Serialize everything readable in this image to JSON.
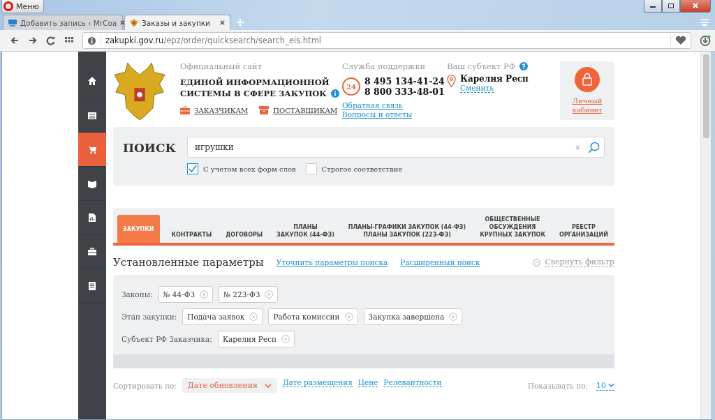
{
  "browser": {
    "menu_label": "Меню",
    "tabs": [
      {
        "title": "Добавить запись ‹ MrCoa",
        "selected": false
      },
      {
        "title": "Заказы и закупки",
        "selected": true
      }
    ],
    "url_host": "zakupki.gov.ru",
    "url_path": "/epz/order/quicksearch/search_eis.html"
  },
  "sidebar": [
    {
      "selected": false
    },
    {
      "selected": false
    },
    {
      "selected": true
    },
    {
      "selected": false
    },
    {
      "selected": false
    },
    {
      "selected": false
    },
    {
      "selected": false
    }
  ],
  "header": {
    "site_caption": "Официальный сайт",
    "site_title_1": "ЕДИНОЙ ИНФОРМАЦИОННОЙ",
    "site_title_2": "СИСТЕМЫ В СФЕРЕ ЗАКУПОК",
    "audience_links": [
      "ЗАКАЗЧИКАМ",
      "ПОСТАВЩИКАМ"
    ],
    "support_caption": "Служба поддержки",
    "support_badge": "24",
    "phones": [
      "8 495 134-41-24",
      "8 800 333-48-01"
    ],
    "support_links": [
      "Обратная связь",
      "Вопросы и ответы"
    ],
    "region_caption": "Ваш субъект РФ",
    "region_name": "Карелия Респ",
    "region_change": "Сменить",
    "cabinet_label": "Личный кабинет"
  },
  "search": {
    "title": "ПОИСК",
    "value": "игрушки",
    "options": [
      {
        "label": "С учетом всех форм слов",
        "checked": true
      },
      {
        "label": "Строгое соответствие",
        "checked": false
      }
    ]
  },
  "sections": [
    {
      "label": "ЗАКУПКИ",
      "selected": true
    },
    {
      "label": "КОНТРАКТЫ",
      "selected": false
    },
    {
      "label": "ДОГОВОРЫ",
      "selected": false
    },
    {
      "label": "ПЛАНЫ\nЗАКУПОК (44-ФЗ)",
      "selected": false
    },
    {
      "label": "ПЛАНЫ-ГРАФИКИ ЗАКУПОК (44-ФЗ)\nПЛАНЫ ЗАКУПОК (223-ФЗ)",
      "selected": false
    },
    {
      "label": "ОБЩЕСТВЕННЫЕ\nОБСУЖДЕНИЯ\nКРУПНЫХ ЗАКУПОК",
      "selected": false
    },
    {
      "label": "РЕЕСТР\nОРГАНИЗАЦИЙ",
      "selected": false
    }
  ],
  "filters": {
    "title": "Установленные параметры",
    "links": [
      "Уточнить параметры поиска",
      "Расширенный поиск"
    ],
    "collapse_label": "Свернуть фильтр",
    "groups": [
      {
        "label": "Законы:",
        "tags": [
          "№ 44-ФЗ",
          "№ 223-ФЗ"
        ]
      },
      {
        "label": "Этап закупки:",
        "tags": [
          "Подача заявок",
          "Работа комиссии",
          "Закупка завершена"
        ]
      },
      {
        "label": "Субъект РФ Заказчика:",
        "tags": [
          "Карелия Респ"
        ]
      }
    ]
  },
  "sorting": {
    "label": "Сортировать по:",
    "options": [
      {
        "label": "Дате обновления",
        "selected": true
      },
      {
        "label": "Дате размещения",
        "selected": false
      },
      {
        "label": "Цене",
        "selected": false
      },
      {
        "label": "Релевантности",
        "selected": false
      }
    ],
    "page_size_label": "Показывать по:",
    "page_size": "10"
  }
}
